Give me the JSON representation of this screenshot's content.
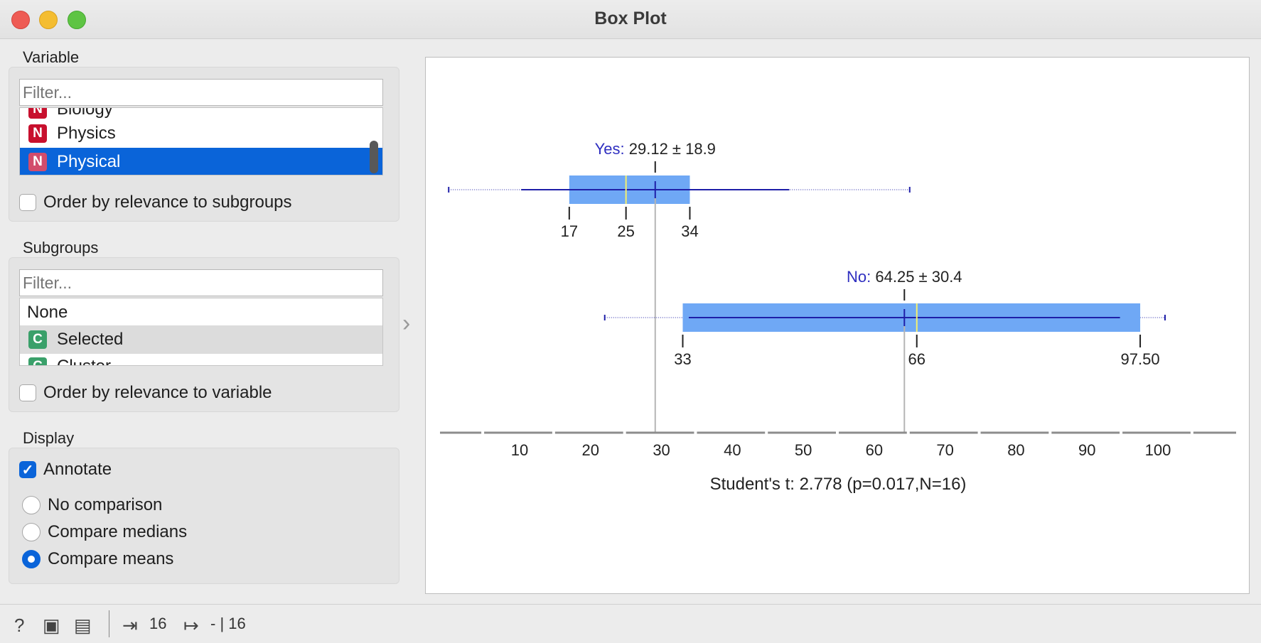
{
  "window": {
    "title": "Box Plot"
  },
  "variable": {
    "label": "Variable",
    "filter_placeholder": "Filter...",
    "items": [
      {
        "badge": "N",
        "label": "Biology"
      },
      {
        "badge": "N",
        "label": "Physics"
      },
      {
        "badge": "N",
        "label": "Physical"
      }
    ],
    "order_label": "Order by relevance to subgroups",
    "order_checked": false
  },
  "subgroups": {
    "label": "Subgroups",
    "filter_placeholder": "Filter...",
    "items": [
      {
        "badge": "",
        "label": "None"
      },
      {
        "badge": "C",
        "label": "Selected"
      },
      {
        "badge": "C",
        "label": "Cluster"
      }
    ],
    "order_label": "Order by relevance to variable",
    "order_checked": false
  },
  "display": {
    "label": "Display",
    "annotate_label": "Annotate",
    "annotate_checked": true,
    "options": [
      "No comparison",
      "Compare medians",
      "Compare means"
    ],
    "selected": "Compare means"
  },
  "status": {
    "input_count": "16",
    "output_count": "- | 16"
  },
  "chart_data": {
    "type": "box",
    "xlim": [
      0,
      110
    ],
    "ticks": [
      10,
      20,
      30,
      40,
      50,
      60,
      70,
      80,
      90,
      100
    ],
    "footer": "Student's t: 2.778 (p=0.017,N=16)",
    "series": [
      {
        "name": "Yes",
        "stat": "29.12 ± 18.9",
        "min": 0,
        "max": 65,
        "q1": 17,
        "median": 25,
        "q3": 34,
        "mean": 29.12,
        "sd": 18.9,
        "labels": [
          "17",
          "25",
          "34"
        ]
      },
      {
        "name": "No",
        "stat": "64.25 ± 30.4",
        "min": 22,
        "max": 101,
        "q1": 33,
        "median": 66,
        "q3": 97.5,
        "mean": 64.25,
        "sd": 30.4,
        "labels": [
          "33",
          "66",
          "97.50"
        ]
      }
    ],
    "colors": {
      "box": "#6fa8f5",
      "whisker": "#1f1fa8",
      "median": "#f5f06e",
      "mean": "#1f1fa8",
      "axis": "#8c8c8c"
    }
  }
}
